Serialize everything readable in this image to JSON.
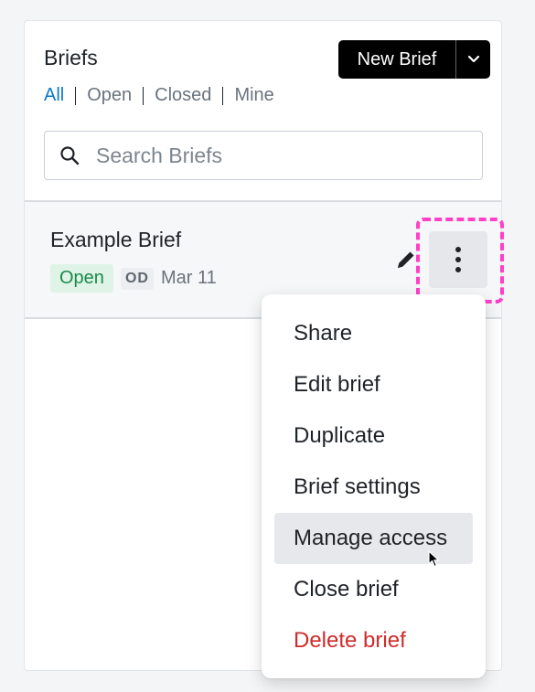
{
  "header": {
    "title": "Briefs",
    "new_button_label": "New Brief"
  },
  "filters": [
    {
      "label": "All",
      "active": true
    },
    {
      "label": "Open",
      "active": false
    },
    {
      "label": "Closed",
      "active": false
    },
    {
      "label": "Mine",
      "active": false
    }
  ],
  "search": {
    "placeholder": "Search Briefs",
    "value": ""
  },
  "briefs": [
    {
      "title": "Example Brief",
      "status": "Open",
      "owner_initials": "OD",
      "date": "Mar 11"
    }
  ],
  "context_menu": {
    "items": [
      {
        "label": "Share"
      },
      {
        "label": "Edit brief"
      },
      {
        "label": "Duplicate"
      },
      {
        "label": "Brief settings"
      },
      {
        "label": "Manage access",
        "hovered": true
      },
      {
        "label": "Close brief"
      },
      {
        "label": "Delete brief",
        "danger": true
      }
    ]
  },
  "colors": {
    "accent": "#0b79c9",
    "status_open_bg": "#dff3e7",
    "status_open_text": "#1a8a4b",
    "danger": "#d12b2b",
    "highlight": "#ff3fc8"
  },
  "icons": {
    "search": "search-icon",
    "edit": "pencil-icon",
    "more": "more-vertical-icon",
    "dropdown": "chevron-down-icon"
  }
}
